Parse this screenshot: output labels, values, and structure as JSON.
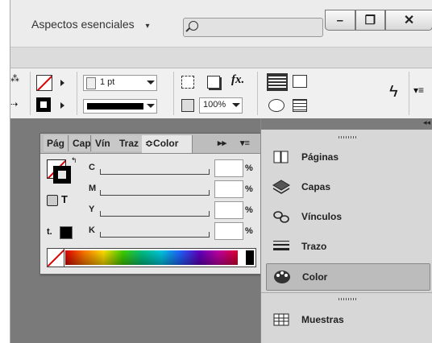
{
  "titlebar": {
    "workspace_label": "Aspectos esenciales",
    "workspace_arrow": "▾",
    "search_value": "",
    "window_buttons": [
      "–",
      "❐",
      "✕"
    ]
  },
  "controlbar": {
    "stroke_weight": "1 pt",
    "zoom_percent": "100%",
    "fx_label": "fx."
  },
  "color_panel": {
    "tabs": [
      "Pág",
      "Cap",
      "Vín",
      "Traz",
      "≎Color"
    ],
    "active_tab": "Color",
    "expand_icon": "▸▸",
    "menu_icon": "▾≡",
    "channels": [
      {
        "label": "C",
        "value": "",
        "unit": "%"
      },
      {
        "label": "M",
        "value": "",
        "unit": "%"
      },
      {
        "label": "Y",
        "value": "",
        "unit": "%"
      },
      {
        "label": "K",
        "value": "",
        "unit": "%"
      }
    ],
    "apply_text_label": "T",
    "tint_label": "t."
  },
  "dock": {
    "collapse_icon": "◂◂",
    "items": [
      {
        "label": "Páginas",
        "icon": "pages-icon",
        "selected": false
      },
      {
        "label": "Capas",
        "icon": "layers-icon",
        "selected": false
      },
      {
        "label": "Vínculos",
        "icon": "links-icon",
        "selected": false
      },
      {
        "label": "Trazo",
        "icon": "stroke-icon",
        "selected": false
      },
      {
        "label": "Color",
        "icon": "color-icon",
        "selected": true
      },
      {
        "label": "Muestras",
        "icon": "swatches-icon",
        "selected": false
      }
    ]
  },
  "colors": {
    "panel_bg": "#e7e7e7",
    "canvas": "#7a7a7a",
    "none_red": "#dd0000"
  }
}
